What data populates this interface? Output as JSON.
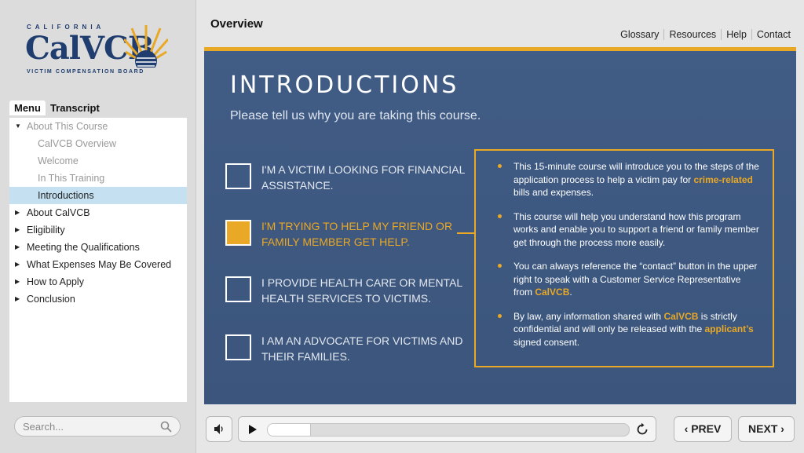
{
  "logo": {
    "top": "CALIFORNIA",
    "main": "CalVCB",
    "sub": "VICTIM COMPENSATION BOARD"
  },
  "sidebar": {
    "tabs": [
      "Menu",
      "Transcript"
    ],
    "items": [
      {
        "label": "About This Course",
        "level": 0,
        "expanded": true
      },
      {
        "label": "CalVCB Overview",
        "level": 1
      },
      {
        "label": "Welcome",
        "level": 1
      },
      {
        "label": "In This Training",
        "level": 1
      },
      {
        "label": "Introductions",
        "level": 1,
        "selected": true
      },
      {
        "label": "About CalVCB",
        "level": 0
      },
      {
        "label": "Eligibility",
        "level": 0
      },
      {
        "label": "Meeting the Qualifications",
        "level": 0
      },
      {
        "label": "What Expenses May Be Covered",
        "level": 0
      },
      {
        "label": "How to Apply",
        "level": 0
      },
      {
        "label": "Conclusion",
        "level": 0
      }
    ],
    "search_placeholder": "Search..."
  },
  "header": {
    "title": "Overview",
    "links": [
      "Glossary",
      "Resources",
      "Help",
      "Contact"
    ]
  },
  "slide": {
    "title": "INTRODUCTIONS",
    "subtitle": "Please tell us why you are taking this course.",
    "options": [
      {
        "text": "I'm a victim looking for financial assistance.",
        "selected": false
      },
      {
        "text": "I'm trying to help my friend or family member get help.",
        "selected": true
      },
      {
        "text": "I provide health care or mental health services to victims.",
        "selected": false
      },
      {
        "text": "I am an advocate for victims and their families.",
        "selected": false
      }
    ],
    "info": [
      {
        "before": "This 15-minute course will introduce you to the steps of the application process to help a victim pay for ",
        "highlight": "crime-related",
        "after": " bills and expenses."
      },
      {
        "before": "This course will help you understand how this program works and enable you to support a friend or family member get through the process more easily.",
        "highlight": "",
        "after": ""
      },
      {
        "before": "You can always reference the “contact” button in the upper right to speak with a Customer Service Representative from ",
        "highlight": "CalVCB",
        "after": "."
      },
      {
        "before": "By law, any information shared with ",
        "highlight": "CalVCB",
        "after": " is strictly confidential and will only be released with the ",
        "highlight2": "applicant’s",
        "after2": " signed consent."
      }
    ]
  },
  "player": {
    "progress": 0.12,
    "prev_label": "PREV",
    "next_label": "NEXT"
  },
  "colors": {
    "accent": "#e9a825",
    "slide_bg": "#3e5980",
    "brand_blue": "#1f3d6e",
    "selected_row": "#c5e0f1"
  }
}
